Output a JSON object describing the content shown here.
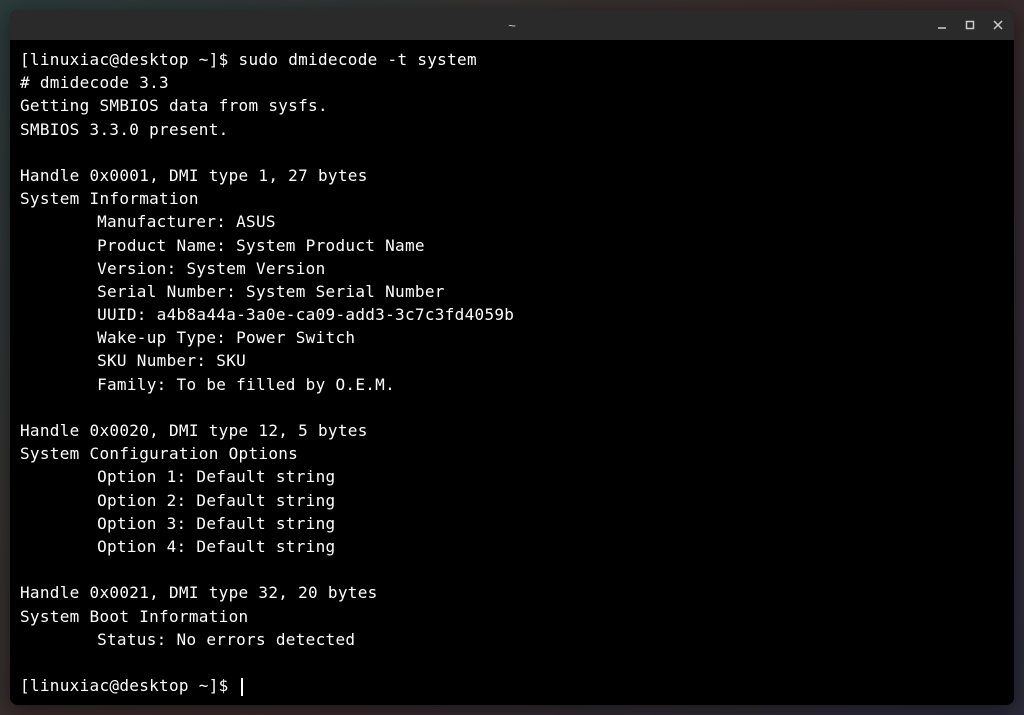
{
  "window": {
    "title": "~"
  },
  "terminal": {
    "prompt1": "[linuxiac@desktop ~]$ ",
    "command1": "sudo dmidecode -t system",
    "out": {
      "l1": "# dmidecode 3.3",
      "l2": "Getting SMBIOS data from sysfs.",
      "l3": "SMBIOS 3.3.0 present.",
      "blank1": "",
      "h1": "Handle 0x0001, DMI type 1, 27 bytes",
      "h1_title": "System Information",
      "h1_manufacturer": "Manufacturer: ASUS",
      "h1_product": "Product Name: System Product Name",
      "h1_version": "Version: System Version",
      "h1_serial": "Serial Number: System Serial Number",
      "h1_uuid": "UUID: a4b8a44a-3a0e-ca09-add3-3c7c3fd4059b",
      "h1_wakeup": "Wake-up Type: Power Switch",
      "h1_sku": "SKU Number: SKU",
      "h1_family": "Family: To be filled by O.E.M.",
      "blank2": "",
      "h2": "Handle 0x0020, DMI type 12, 5 bytes",
      "h2_title": "System Configuration Options",
      "h2_opt1": "Option 1: Default string",
      "h2_opt2": "Option 2: Default string",
      "h2_opt3": "Option 3: Default string",
      "h2_opt4": "Option 4: Default string",
      "blank3": "",
      "h3": "Handle 0x0021, DMI type 32, 20 bytes",
      "h3_title": "System Boot Information",
      "h3_status": "Status: No errors detected",
      "blank4": ""
    },
    "prompt2": "[linuxiac@desktop ~]$ "
  }
}
